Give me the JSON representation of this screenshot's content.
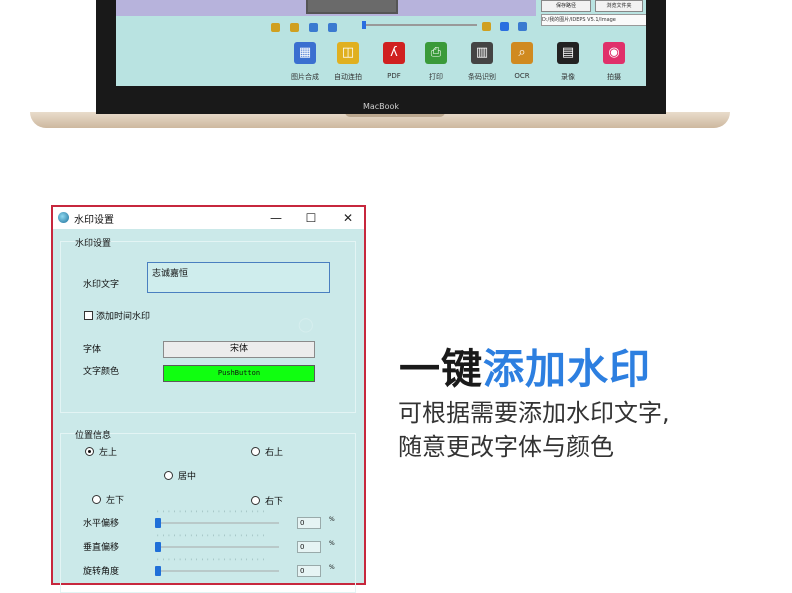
{
  "laptop": {
    "brand": "MacBook",
    "screen": {
      "buttons": {
        "save_path": "保存路径",
        "browse_folder": "浏览文件夹"
      },
      "path": "D:/我的图片/IDEPS V5.1/Image",
      "toolbar": [
        {
          "label": "图片合成",
          "icon": "image-merge-icon",
          "color": "#3a6fd0"
        },
        {
          "label": "自动连拍",
          "icon": "auto-burst-icon",
          "color": "#e0b020"
        },
        {
          "label": "PDF",
          "icon": "pdf-icon",
          "color": "#d02020"
        },
        {
          "label": "打印",
          "icon": "printer-icon",
          "color": "#3a9a3a"
        },
        {
          "label": "条码识别",
          "icon": "barcode-icon",
          "color": "#444444"
        },
        {
          "label": "OCR",
          "icon": "ocr-magnifier-icon",
          "color": "#d08a20"
        },
        {
          "label": "录像",
          "icon": "clapperboard-icon",
          "color": "#222222"
        },
        {
          "label": "拍摄",
          "icon": "camera-icon",
          "color": "#e0306a"
        }
      ]
    }
  },
  "dialog": {
    "title": "水印设置",
    "controls": {
      "minimize": "—",
      "maximize": "☐",
      "close": "✕"
    },
    "watermark_group": {
      "title": "水印设置",
      "text_label": "水印文字",
      "text_value": "志诚嘉恒",
      "add_time_label": "添加时间水印",
      "add_time_checked": false,
      "font_label": "字体",
      "font_value": "宋体",
      "color_label": "文字颜色",
      "color_button": "PushButton",
      "color_value": "#10ff10"
    },
    "position_group": {
      "title": "位置信息",
      "options": {
        "top_left": "左上",
        "top_right": "右上",
        "center": "居中",
        "bottom_left": "左下",
        "bottom_right": "右下"
      },
      "selected": "左上",
      "sliders": [
        {
          "label": "水平偏移",
          "value": "0",
          "unit": "%"
        },
        {
          "label": "垂直偏移",
          "value": "0",
          "unit": "%"
        },
        {
          "label": "旋转角度",
          "value": "0",
          "unit": "%"
        }
      ]
    }
  },
  "marketing": {
    "headline_dark": "一键",
    "headline_accent": "添加水印",
    "accent_color": "#2d7fe0",
    "description_line1": "可根据需要添加水印文字,",
    "description_line2": "随意更改字体与颜色"
  }
}
